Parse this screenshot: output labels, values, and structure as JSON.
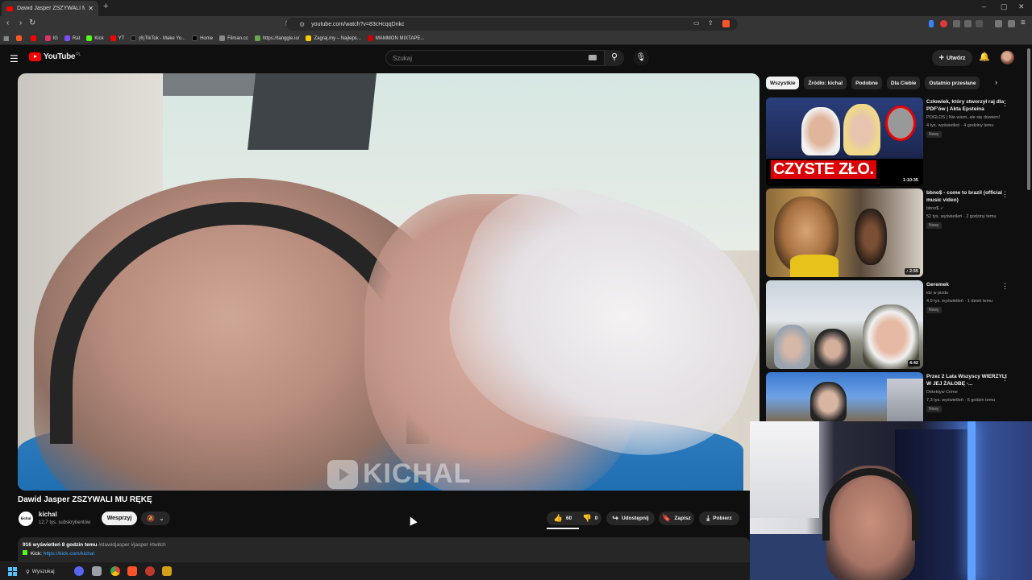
{
  "browser": {
    "tab_title": "Dawid Jasper ZSZYWALI MU RĘKĘ",
    "url": "youtube.com/watch?v=83cHcqqDnkc",
    "bookmarks": [
      {
        "label": "",
        "color": "#ff5722"
      },
      {
        "label": "",
        "color": "#ff0000"
      },
      {
        "label": "IG",
        "color": "#e1306c"
      },
      {
        "label": "Rat",
        "color": "#7c4dff"
      },
      {
        "label": "Kick",
        "color": "#53fc18"
      },
      {
        "label": "YT",
        "color": "#ff0000"
      },
      {
        "label": "(6)TikTok - Make Yo...",
        "color": "#111111"
      },
      {
        "label": "Home",
        "color": "#000000"
      },
      {
        "label": "Filman.cc",
        "color": "#888888"
      },
      {
        "label": "https://tanggle.io/",
        "color": "#6aa84f"
      },
      {
        "label": "Zagraj.my – Najleps...",
        "color": "#ffcc00"
      },
      {
        "label": "MAMMON MIXTAPE...",
        "color": "#cc0000"
      }
    ]
  },
  "youtube": {
    "logo_text": "YouTube",
    "country": "PL",
    "search_placeholder": "Szukaj",
    "create_label": "Utwórz"
  },
  "video": {
    "title": "Dawid Jasper ZSZYWALI MU RĘKĘ",
    "watermark": "KICHAL",
    "channel": "kichal",
    "channel_logo_text": "kichal",
    "subscribers": "12,7 tys. subskrybentów",
    "support_label": "Wesprzyj",
    "likes": "60",
    "dislikes": "0",
    "share_label": "Udostępnij",
    "save_label": "Zapisz",
    "download_label": "Pobierz",
    "views_time": "916 wyświetleń  8 godzin temu",
    "hashtags": "#dawidjasper #jasper #twitch",
    "kick_prefix": "Kick:",
    "kick_link": "https://kick.com/kichal"
  },
  "sidebar": {
    "chips": [
      "Wszystkie",
      "Źródło: kichal",
      "Podobne",
      "Dla Ciebie",
      "Ostatnio przesłane"
    ],
    "recommendations": [
      {
        "title": "Człowiek, który stworzył raj dla PDF'ów | Akta Epsteina",
        "channel": "POGLOS | Nie wiem, ale się dowiem!",
        "views": "4 tys. wyświetleń · 4 godziny temu",
        "badge": "Nowy",
        "duration": "1:10:35",
        "thumb_text": "CZYSTE ZŁO."
      },
      {
        "title": "bbno$ - come to brazil (official music video)",
        "channel": "bbno$",
        "views": "52 tys. wyświetleń · 2 godziny temu",
        "badge": "Nowy",
        "duration": "2:55",
        "verified": "✓"
      },
      {
        "title": "Geremek",
        "channel": "idz w pizdu",
        "views": "4,9 tys. wyświetleń · 1 dzień temu",
        "badge": "Nowy",
        "duration": "4:42"
      },
      {
        "title": "Przez 2 Lata Wszyscy WIERZYLI W JEJ ŻAŁOBĘ -...",
        "channel": "Detektyw Crime",
        "views": "7,3 tys. wyświetleń · 5 godzin temu",
        "badge": "Nowy",
        "duration": ""
      }
    ]
  },
  "taskbar": {
    "search_label": "Wyszukaj"
  },
  "colors": {
    "youtube_red": "#ff0000",
    "background": "#0f0f0f",
    "link_blue": "#3ea6ff"
  }
}
